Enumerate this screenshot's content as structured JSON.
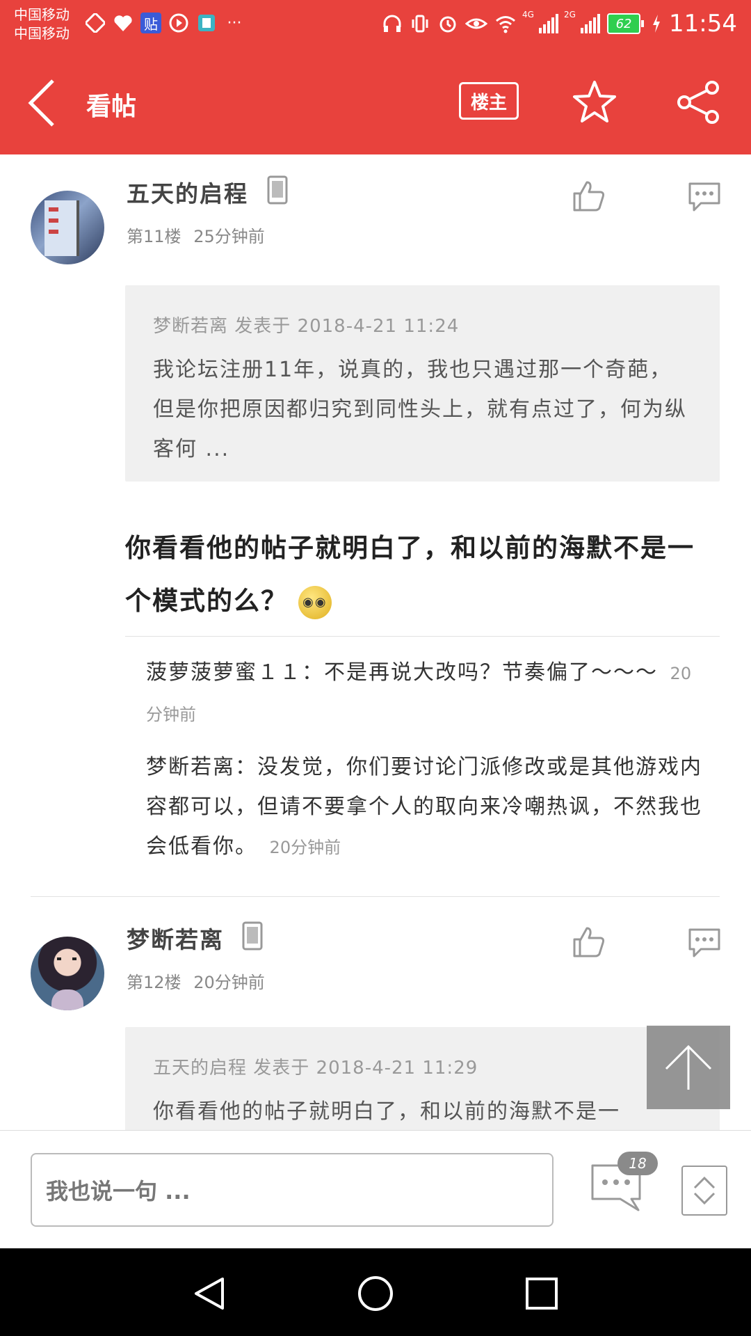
{
  "status_bar": {
    "carrier_1": "中国移动",
    "carrier_2": "中国移动",
    "app_icons": [
      "transit-icon",
      "heart-health-icon",
      "tieba-icon",
      "play-icon",
      "book-icon",
      "more-dots-icon"
    ],
    "tieba_glyph": "贴",
    "more_glyph": "···",
    "network_1": "4G",
    "network_2": "2G",
    "battery": "62",
    "time": "11:54"
  },
  "app_bar": {
    "title": "看帖",
    "op_only_label": "楼主"
  },
  "posts": [
    {
      "author": "五天的启程",
      "floor": "第11楼",
      "time": "25分钟前",
      "quote_head": "梦断若离 发表于 2018-4-21 11:24",
      "quote_text": "我论坛注册11年，说真的，我也只遇过那一个奇葩，但是你把原因都归究到同性头上，就有点过了，何为纵客何 ...",
      "body": "你看看他的帖子就明白了，和以前的海默不是一个模式的么？",
      "emoji_glyph": "◉◉",
      "sub_replies": [
        {
          "text": "菠萝菠萝蜜１１：不是再说大改吗？节奏偏了～～～",
          "time": "20分钟前"
        },
        {
          "text": "梦断若离：没发觉，你们要讨论门派修改或是其他游戏内容都可以，但请不要拿个人的取向来冷嘲热讽，不然我也会低看你。",
          "time": "20分钟前"
        }
      ]
    },
    {
      "author": "梦断若离",
      "floor": "第12楼",
      "time": "20分钟前",
      "quote_head": "五天的启程 发表于 2018-4-21 11:29",
      "quote_text": "你看看他的帖子就明白了，和以前的海默不是一"
    }
  ],
  "bottom_bar": {
    "input_placeholder": "我也说一句 ...",
    "comment_count": "18"
  },
  "colors": {
    "brand_red": "#e8423d",
    "quote_bg": "#f0f0f0",
    "nav_bg": "#000000"
  }
}
